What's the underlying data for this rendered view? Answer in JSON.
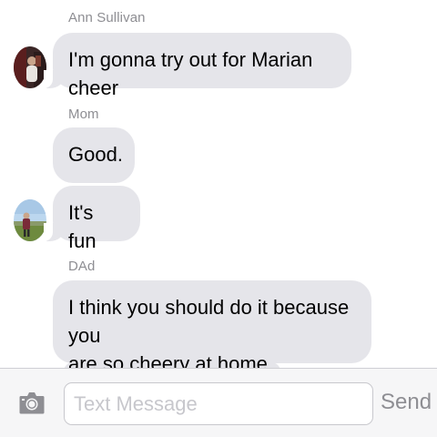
{
  "messages": [
    {
      "sender": "Ann Sullivan",
      "text": "I'm gonna try out for Marian cheer",
      "avatar": "photo"
    },
    {
      "sender": "Mom",
      "texts": [
        "Good.",
        "It's fun"
      ],
      "avatar": "photo"
    },
    {
      "sender": "DAd",
      "lines": [
        "I think you should do it because you",
        "are so cheery at home."
      ]
    }
  ],
  "composer": {
    "placeholder": "Text Message",
    "send_label": "Send",
    "camera_icon": "camera-icon"
  },
  "colors": {
    "bubble_gray": "#e5e5ea",
    "sender_gray": "#8e8e93",
    "composer_bg": "#f6f6f7"
  }
}
